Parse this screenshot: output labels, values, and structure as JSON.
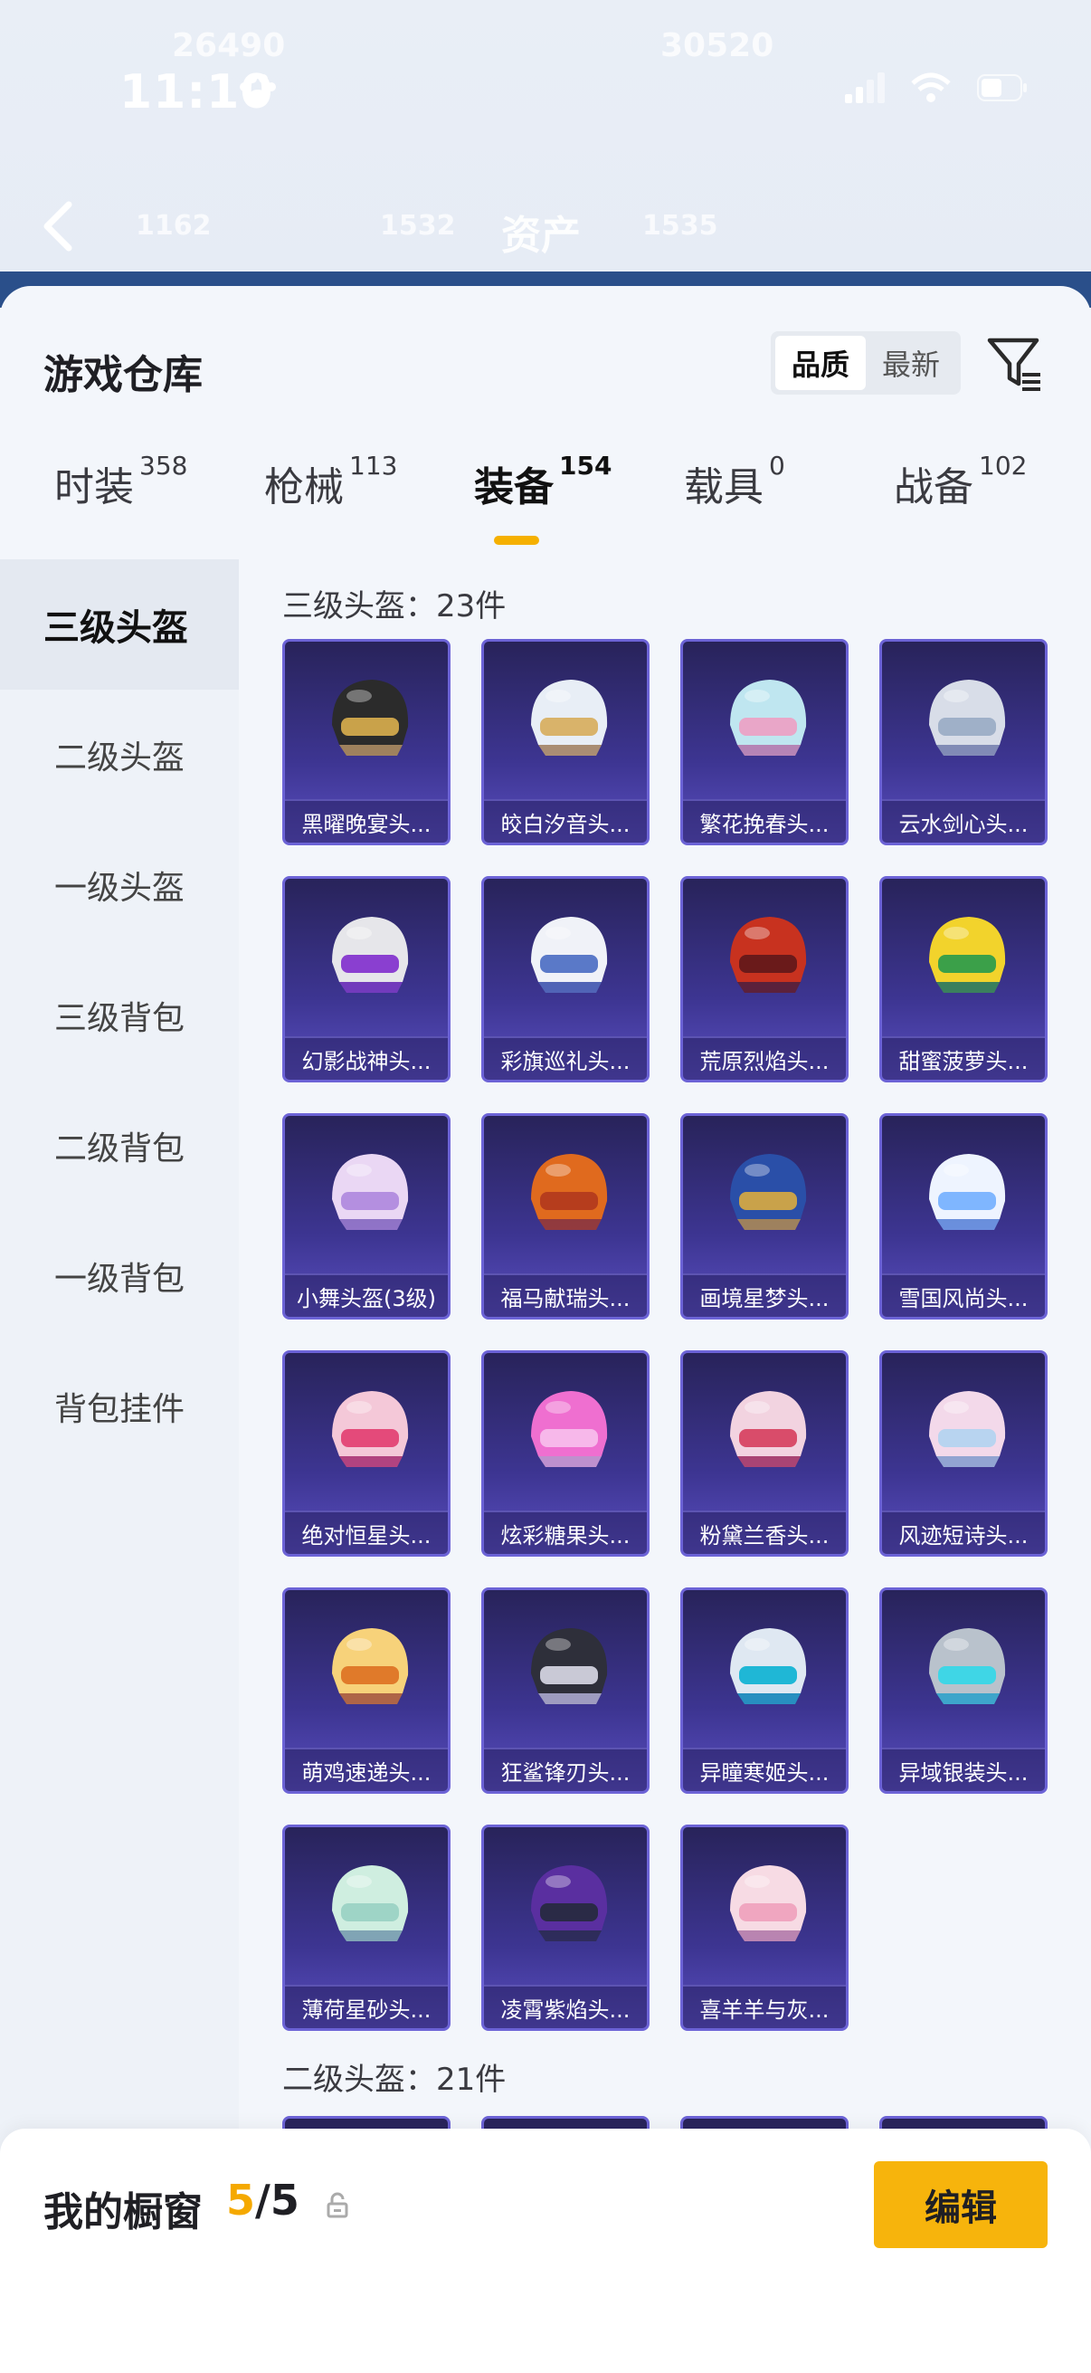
{
  "status_bar": {
    "time": "11:10"
  },
  "header": {
    "title": "资产",
    "faded_values": [
      "26490",
      "30520",
      "1162",
      "1532",
      "1535"
    ]
  },
  "warehouse": {
    "title": "游戏仓库",
    "sort_options": [
      "品质",
      "最新"
    ],
    "active_sort": "品质"
  },
  "tabs": [
    {
      "label": "时装",
      "count": "358"
    },
    {
      "label": "枪械",
      "count": "113"
    },
    {
      "label": "装备",
      "count": "154"
    },
    {
      "label": "载具",
      "count": "0"
    },
    {
      "label": "战备",
      "count": "102"
    }
  ],
  "active_tab": "装备",
  "sidebar": {
    "items": [
      "三级头盔",
      "二级头盔",
      "一级头盔",
      "三级背包",
      "二级背包",
      "一级背包",
      "背包挂件"
    ]
  },
  "sections": [
    {
      "title": "三级头盔：23件"
    },
    {
      "title": "二级头盔：21件"
    }
  ],
  "items": [
    {
      "name": "黑曜晚宴头...",
      "icon": "helmet-black"
    },
    {
      "name": "皎白汐音头...",
      "icon": "helmet-white"
    },
    {
      "name": "繁花挽春头...",
      "icon": "helmet-flower"
    },
    {
      "name": "云水剑心头...",
      "icon": "helmet-silver"
    },
    {
      "name": "幻影战神头...",
      "icon": "helmet-phantom"
    },
    {
      "name": "彩旗巡礼头...",
      "icon": "helmet-flag"
    },
    {
      "name": "荒原烈焰头...",
      "icon": "helmet-red"
    },
    {
      "name": "甜蜜菠萝头...",
      "icon": "helmet-pineapple"
    },
    {
      "name": "小舞头盔(3级)",
      "icon": "helmet-bunny"
    },
    {
      "name": "福马献瑞头...",
      "icon": "helmet-horse"
    },
    {
      "name": "画境星梦头...",
      "icon": "helmet-blue"
    },
    {
      "name": "雪国风尚头...",
      "icon": "helmet-snow"
    },
    {
      "name": "绝对恒星头...",
      "icon": "helmet-star"
    },
    {
      "name": "炫彩糖果头...",
      "icon": "helmet-candy"
    },
    {
      "name": "粉黛兰香头...",
      "icon": "helmet-pink"
    },
    {
      "name": "风迹短诗头...",
      "icon": "helmet-wind"
    },
    {
      "name": "萌鸡速递头...",
      "icon": "helmet-chick"
    },
    {
      "name": "狂鲨锋刃头...",
      "icon": "helmet-shark"
    },
    {
      "name": "异瞳寒姬头...",
      "icon": "helmet-ice"
    },
    {
      "name": "异域银装头...",
      "icon": "helmet-silverarmor"
    },
    {
      "name": "薄荷星砂头...",
      "icon": "helmet-mint"
    },
    {
      "name": "凌霄紫焰头...",
      "icon": "helmet-purple"
    },
    {
      "name": "喜羊羊与灰...",
      "icon": "helmet-sheep"
    }
  ],
  "bottom_bar": {
    "label": "我的橱窗",
    "current": "5",
    "total": "/5",
    "edit_label": "编辑"
  },
  "colors": {
    "accent": "#f5b000",
    "card_top": "#28235a",
    "card_bottom": "#5a4fc0"
  }
}
